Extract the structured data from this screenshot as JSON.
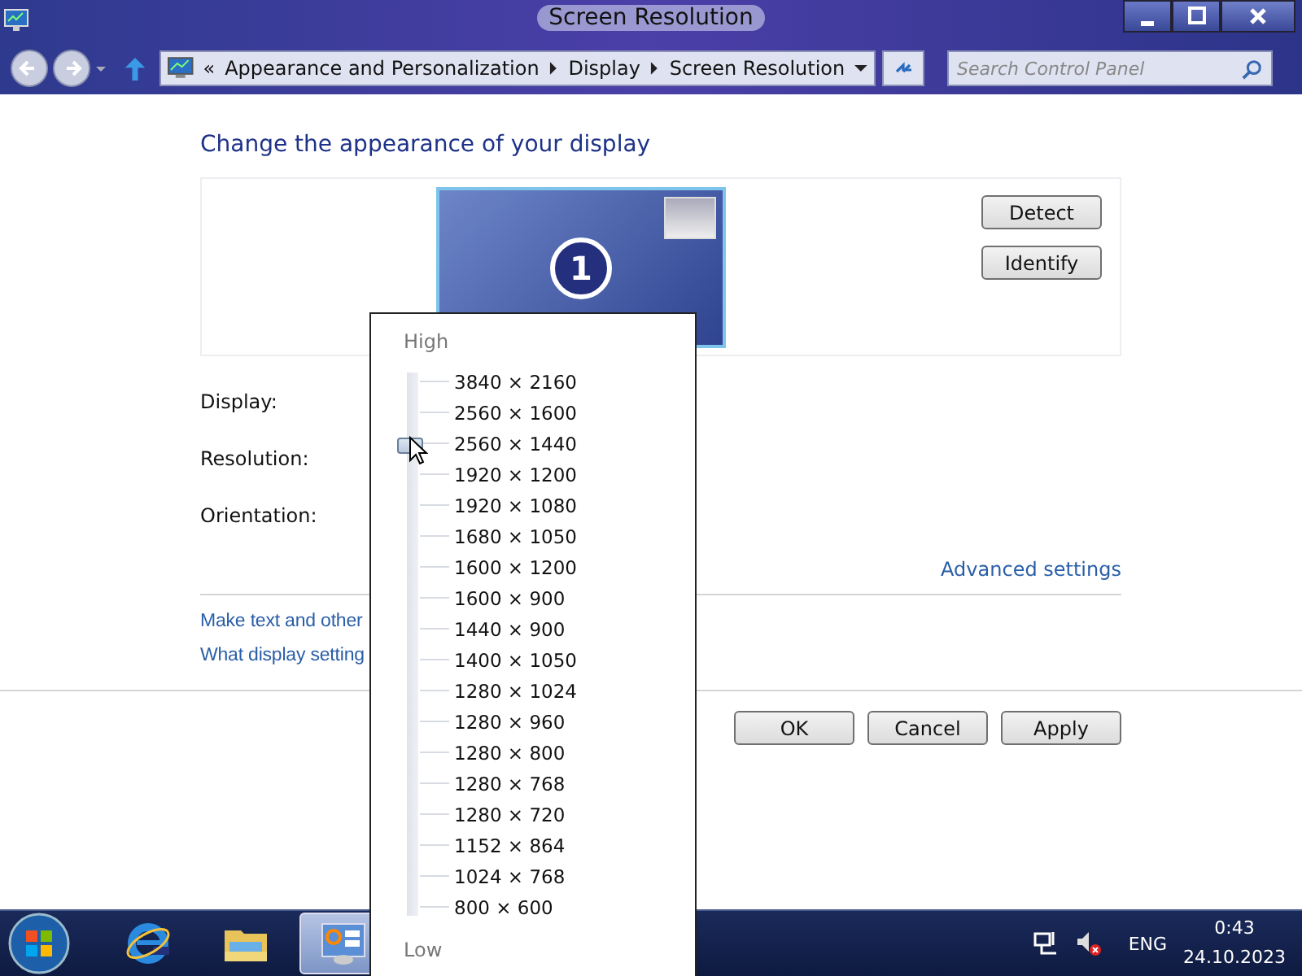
{
  "window": {
    "title": "Screen Resolution"
  },
  "address_bar": {
    "overflow": "«",
    "crumbs": [
      "Appearance and Personalization",
      "Display",
      "Screen Resolution"
    ]
  },
  "search": {
    "placeholder": "Search Control Panel"
  },
  "heading": "Change the appearance of your display",
  "monitor": {
    "number": "1"
  },
  "side_buttons": [
    "Detect",
    "Identify"
  ],
  "fields": [
    "Display:",
    "Resolution:",
    "Orientation:"
  ],
  "advanced_link": "Advanced settings",
  "links": [
    "Make text and other",
    "What display setting"
  ],
  "buttons": [
    "OK",
    "Cancel",
    "Apply"
  ],
  "resolution_popup": {
    "high_label": "High",
    "low_label": "Low",
    "level": 0.88,
    "options": [
      "3840 × 2160",
      "2560 × 1600",
      "2560 × 1440",
      "1920 × 1200",
      "1920 × 1080",
      "1680 × 1050",
      "1600 × 1200",
      "1600 × 900",
      "1440 × 900",
      "1400 × 1050",
      "1280 × 1024",
      "1280 × 960",
      "1280 × 800",
      "1280 × 768",
      "1280 × 720",
      "1152 × 864",
      "1024 × 768",
      "800 × 600"
    ]
  },
  "taskbar": {
    "items": [
      {
        "kind": "ie",
        "selected": false
      },
      {
        "kind": "folder",
        "selected": false
      },
      {
        "kind": "control-panel",
        "selected": true
      }
    ],
    "language": "ENG",
    "time": "0:43",
    "date": "24.10.2023"
  }
}
